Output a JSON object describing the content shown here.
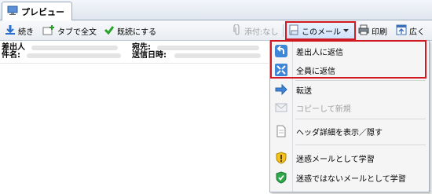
{
  "tab": {
    "label": "プレビュー"
  },
  "toolbar": {
    "continue": "続き",
    "full_text_in_tab": "タブで全文",
    "mark_read": "既読にする",
    "attachments": "添付:なし",
    "this_mail": "このメール",
    "print": "印刷",
    "expand": "広く"
  },
  "header": {
    "from_label": "差出人",
    "subject_label": "件名:",
    "to_label": "宛先:",
    "date_label": "送信日時:"
  },
  "menu": {
    "reply_sender": "差出人に返信",
    "reply_all": "全員に返信",
    "forward": "転送",
    "copy_new": "コピーして新規",
    "toggle_header": "ヘッダ詳細を表示／隠す",
    "learn_junk": "迷惑メールとして学習",
    "learn_not_junk": "迷惑ではないメールとして学習"
  }
}
